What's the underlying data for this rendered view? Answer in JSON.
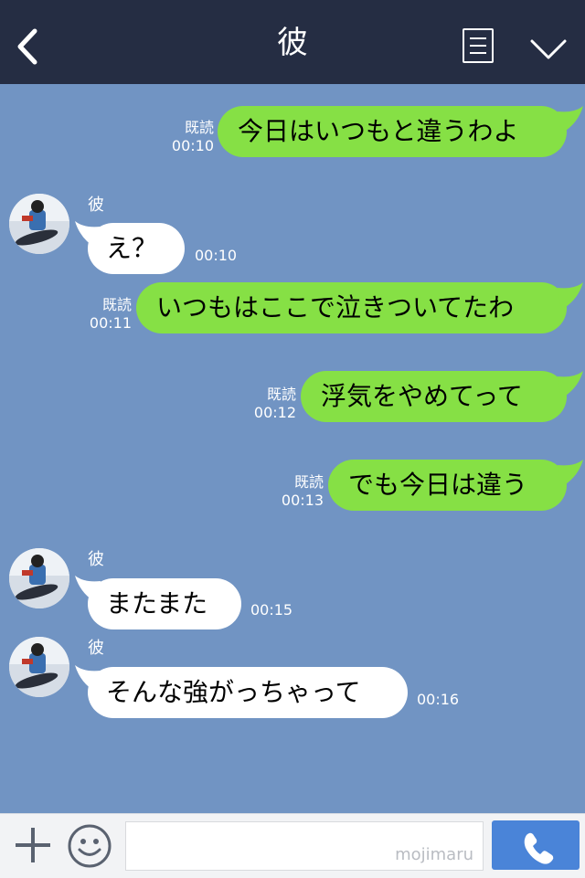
{
  "header": {
    "title": "彼"
  },
  "messages": [
    {
      "side": "out",
      "text": "今日はいつもと違うわよ",
      "read": "既読",
      "time": "00:10"
    },
    {
      "side": "in",
      "sender": "彼",
      "text": "え？",
      "time": "00:10"
    },
    {
      "side": "out",
      "text": "いつもはここで泣きついてたわ",
      "read": "既読",
      "time": "00:11"
    },
    {
      "side": "out",
      "text": "浮気をやめてって",
      "read": "既読",
      "time": "00:12"
    },
    {
      "side": "out",
      "text": "でも今日は違う",
      "read": "既読",
      "time": "00:13"
    },
    {
      "side": "in",
      "sender": "彼",
      "text": "またまた",
      "time": "00:15"
    },
    {
      "side": "in",
      "sender": "彼",
      "text": "そんな強がっちゃって",
      "time": "00:16"
    }
  ],
  "input": {
    "watermark": "mojimaru",
    "placeholder": ""
  },
  "colors": {
    "header": "#252d43",
    "background": "#7194c3",
    "outgoing": "#86e045",
    "incoming": "#ffffff",
    "call": "#4a84d8"
  },
  "icons": {
    "back": "chevron-left-icon",
    "note": "note-icon",
    "menu": "chevron-down-icon",
    "add": "plus-icon",
    "emoji": "smiley-icon",
    "call": "phone-icon"
  }
}
